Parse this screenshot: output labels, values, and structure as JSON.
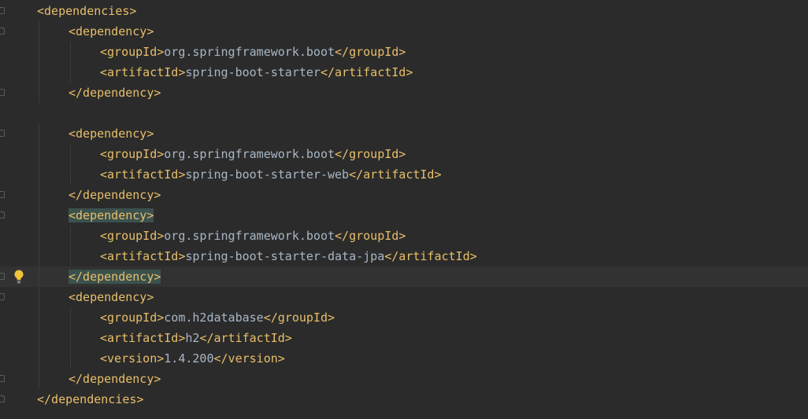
{
  "editor": {
    "lines": [
      {
        "indent": 0,
        "open": "<dependencies>",
        "text": "",
        "close": ""
      },
      {
        "indent": 1,
        "open": "<dependency>",
        "text": "",
        "close": ""
      },
      {
        "indent": 2,
        "open": "<groupId>",
        "text": "org.springframework.boot",
        "close": "</groupId>"
      },
      {
        "indent": 2,
        "open": "<artifactId>",
        "text": "spring-boot-starter",
        "close": "</artifactId>"
      },
      {
        "indent": 1,
        "open": "</dependency>",
        "text": "",
        "close": ""
      },
      {
        "indent": 0,
        "open": "",
        "text": "",
        "close": ""
      },
      {
        "indent": 1,
        "open": "<dependency>",
        "text": "",
        "close": ""
      },
      {
        "indent": 2,
        "open": "<groupId>",
        "text": "org.springframework.boot",
        "close": "</groupId>"
      },
      {
        "indent": 2,
        "open": "<artifactId>",
        "text": "spring-boot-starter-web",
        "close": "</artifactId>"
      },
      {
        "indent": 1,
        "open": "</dependency>",
        "text": "",
        "close": ""
      },
      {
        "indent": 1,
        "open": "<dependency>",
        "text": "",
        "close": ""
      },
      {
        "indent": 2,
        "open": "<groupId>",
        "text": "org.springframework.boot",
        "close": "</groupId>"
      },
      {
        "indent": 2,
        "open": "<artifactId>",
        "text": "spring-boot-starter-data-jpa",
        "close": "</artifactId>"
      },
      {
        "indent": 1,
        "open": "</dependency>",
        "text": "",
        "close": ""
      },
      {
        "indent": 1,
        "open": "<dependency>",
        "text": "",
        "close": ""
      },
      {
        "indent": 2,
        "open": "<groupId>",
        "text": "com.h2database",
        "close": "</groupId>"
      },
      {
        "indent": 2,
        "open": "<artifactId>",
        "text": "h2",
        "close": "</artifactId>"
      },
      {
        "indent": 2,
        "open": "<version>",
        "text": "1.4.200",
        "close": "</version>"
      },
      {
        "indent": 1,
        "open": "</dependency>",
        "text": "",
        "close": ""
      },
      {
        "indent": 0,
        "open": "</dependencies>",
        "text": "",
        "close": ""
      }
    ],
    "current_line": 13,
    "matched_tag_lines": [
      10,
      13
    ],
    "fold_open_lines": [
      0,
      1,
      6,
      10,
      14
    ],
    "fold_close_lines": [
      4,
      9,
      13,
      18,
      19
    ],
    "intention_bulb_line": 13
  },
  "colors": {
    "background": "#2b2b2b",
    "current_line": "#323232",
    "tag": "#e8bf6a",
    "text": "#a9b7c6",
    "tag_match_highlight": "#3b514d",
    "bulb": "#f2c23c"
  },
  "icons": {
    "intention": "lightbulb-icon",
    "fold": "fold-marker-icon"
  }
}
